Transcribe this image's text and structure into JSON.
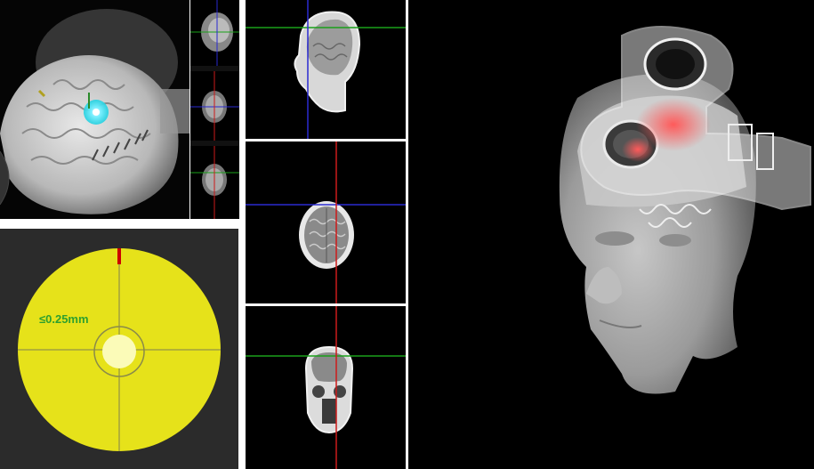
{
  "target_view": {
    "tolerance_label": "≤0.25mm",
    "colors": {
      "disc": "#e6e21a",
      "background": "#2b2b2b",
      "indicator": "#cc0000",
      "label": "#2ea02e"
    }
  },
  "views": {
    "brain_3d": "brain-3d-view",
    "sagittal": "sagittal-mri-view",
    "axial": "axial-mri-view",
    "coronal": "coronal-mri-view",
    "head_3d": "head-3d-render"
  },
  "crosshair_colors": {
    "horizontal": "#1aa01a",
    "vertical_blue": "#2a2ad0",
    "vertical_red": "#cc1a1a",
    "panel_divider": "#cfcfcf"
  }
}
